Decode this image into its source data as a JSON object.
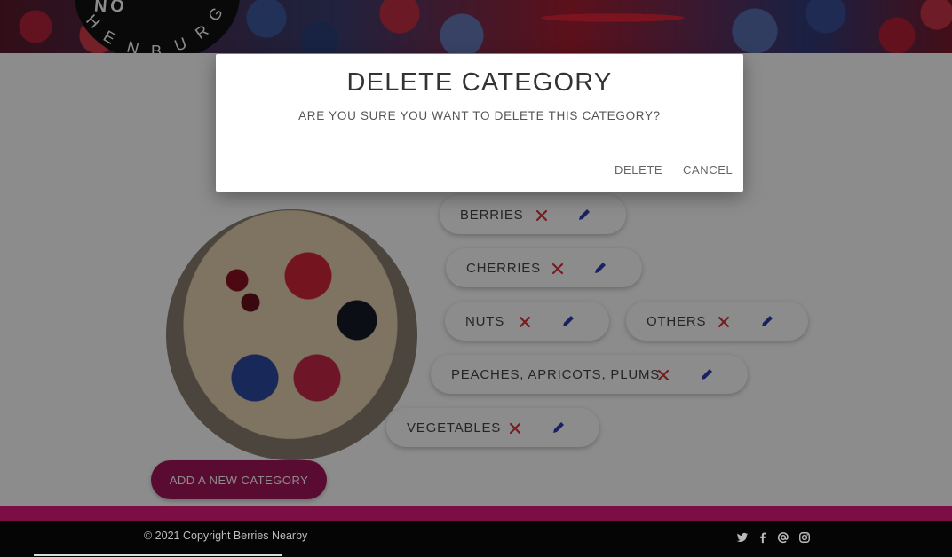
{
  "header": {
    "logo_letters": [
      "H",
      "E",
      "N",
      "B",
      "U",
      "R",
      "G",
      "N",
      "O"
    ]
  },
  "categories": [
    {
      "label": "BERRIES"
    },
    {
      "label": "CHERRIES"
    },
    {
      "label": "NUTS"
    },
    {
      "label": "OTHERS"
    },
    {
      "label": "PEACHES, APRICOTS, PLUMS"
    },
    {
      "label": "VEGETABLES"
    }
  ],
  "add_button_label": "ADD A NEW CATEGORY",
  "footer": {
    "copyright": "© 2021 Copyright Berries Nearby",
    "social_icons": [
      "twitter-icon",
      "facebook-icon",
      "at-icon",
      "instagram-icon"
    ]
  },
  "dialog": {
    "title": "DELETE CATEGORY",
    "message": "ARE YOU SURE YOU WANT TO DELETE THIS CATEGORY?",
    "delete_label": "DELETE",
    "cancel_label": "CANCEL"
  },
  "colors": {
    "accent": "#a5145c",
    "footer_bar": "#7d0e45",
    "delete_icon": "#d9363e",
    "edit_icon": "#2f3fb0"
  }
}
